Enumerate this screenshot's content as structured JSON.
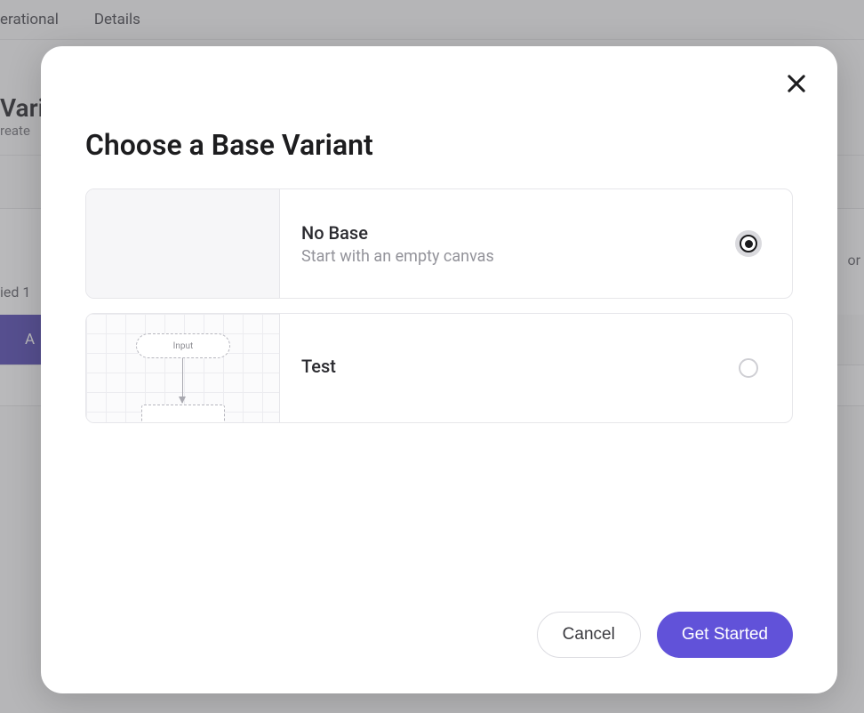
{
  "background": {
    "tabs": [
      "erational",
      "Details"
    ],
    "heading_fragment": "Vari",
    "sub_fragment": "reate",
    "right_text_fragment": "or",
    "left_text_fragment": "ied 1",
    "button_fragment": "A"
  },
  "modal": {
    "title": "Choose a Base Variant",
    "options": [
      {
        "title": "No Base",
        "description": "Start with an empty canvas",
        "selected": true,
        "thumb": "blank"
      },
      {
        "title": "Test",
        "description": "",
        "selected": false,
        "thumb": "flow",
        "thumb_node_label": "Input"
      }
    ],
    "footer": {
      "cancel": "Cancel",
      "confirm": "Get Started"
    }
  }
}
